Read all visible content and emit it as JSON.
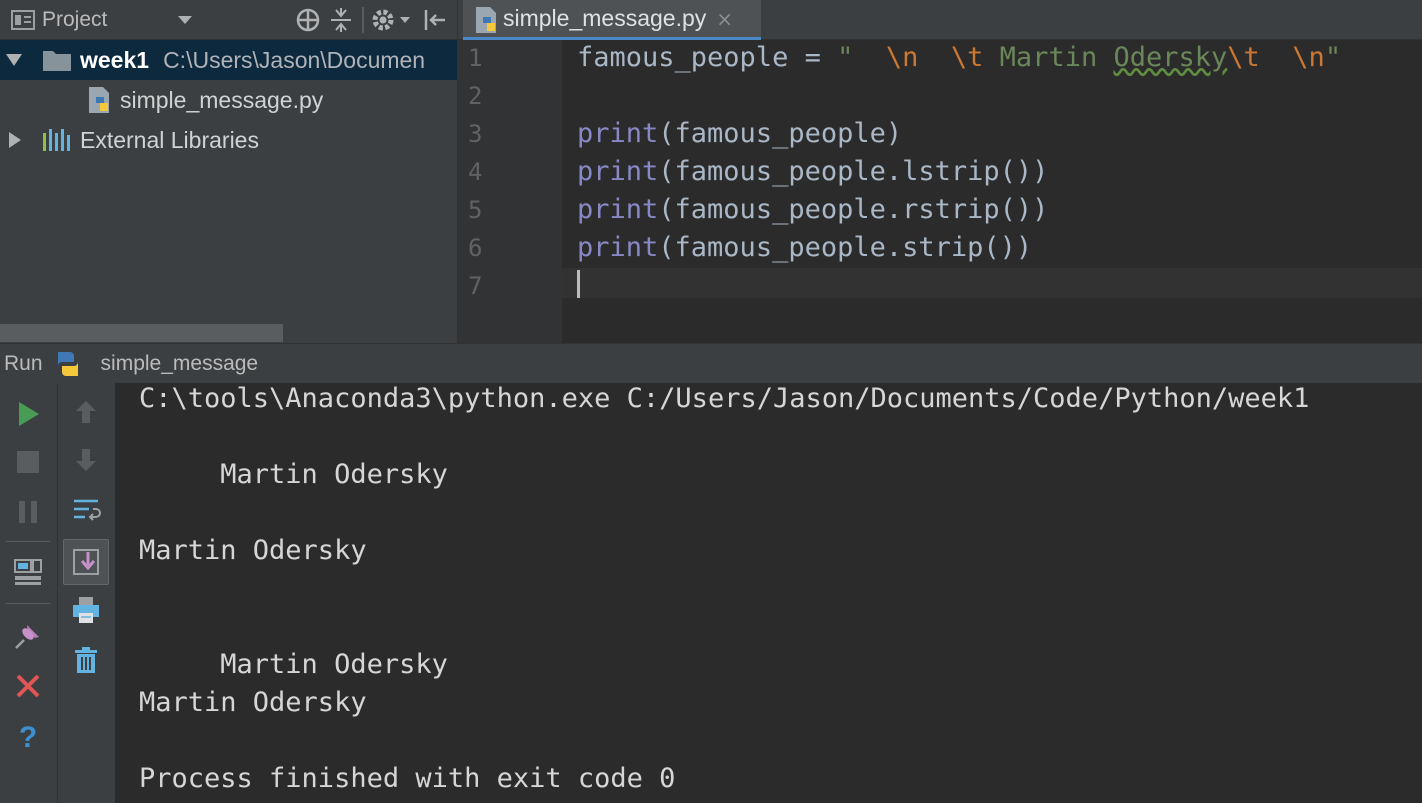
{
  "project_panel": {
    "title": "Project",
    "tree": [
      {
        "name": "week1",
        "path": "C:\\Users\\Jason\\Documen"
      },
      {
        "name": "simple_message.py"
      },
      {
        "name": "External Libraries"
      }
    ]
  },
  "editor": {
    "tab_label": "simple_message.py",
    "tab_close": "×",
    "line_numbers": [
      "1",
      "2",
      "3",
      "4",
      "5",
      "6",
      "7"
    ],
    "line1": {
      "var": "famous_people = ",
      "q1": "\"  ",
      "e1": "\\n",
      "s1": "  ",
      "e2": "\\t",
      "s2": " Martin ",
      "s3": "Odersky",
      "e3": "\\t",
      "s4": "  ",
      "e4": "\\n",
      "q2": "\""
    },
    "print_kw": "print",
    "lines": [
      "(famous_people)",
      "(famous_people.lstrip())",
      "(famous_people.rstrip())",
      "(famous_people.strip())"
    ]
  },
  "run_panel": {
    "run_label": "Run",
    "config_name": "simple_message",
    "output": [
      "C:\\tools\\Anaconda3\\python.exe C:/Users/Jason/Documents/Code/Python/week1",
      "",
      "     Martin Odersky",
      "",
      "Martin Odersky",
      "",
      "",
      "",
      "     Martin Odersky",
      "Martin Odersky",
      "",
      "Process finished with exit code 0"
    ]
  }
}
